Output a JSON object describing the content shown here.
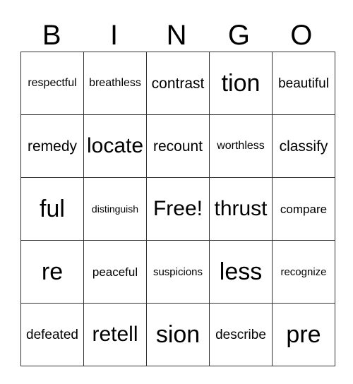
{
  "header": [
    "B",
    "I",
    "N",
    "G",
    "O"
  ],
  "rows": [
    [
      "respectful",
      "breathless",
      "contrast",
      "tion",
      "beautiful"
    ],
    [
      "remedy",
      "locate",
      "recount",
      "worthless",
      "classify"
    ],
    [
      "ful",
      "distinguish",
      "Free!",
      "thrust",
      "compare"
    ],
    [
      "re",
      "peaceful",
      "suspicions",
      "less",
      "recognize"
    ],
    [
      "defeated",
      "retell",
      "sion",
      "describe",
      "pre"
    ]
  ]
}
